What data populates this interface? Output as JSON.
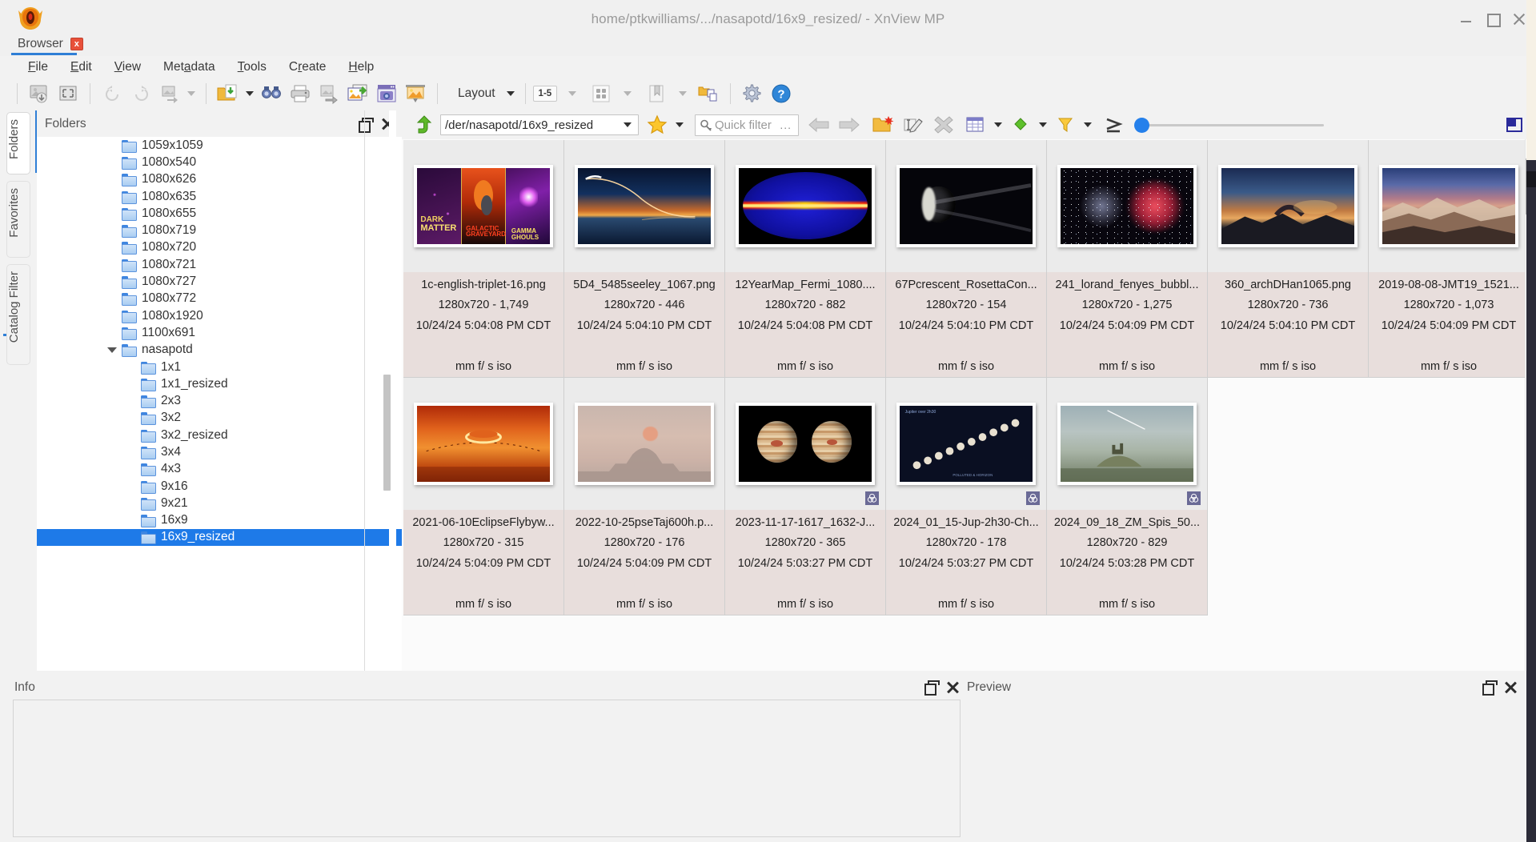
{
  "window": {
    "title": "home/ptkwilliams/.../nasapotd/16x9_resized/ - XnView MP",
    "minimize_label": "Minimize",
    "maximize_label": "Maximize",
    "close_label": "Close"
  },
  "tab": {
    "label": "Browser",
    "close_label": "x"
  },
  "menu": [
    {
      "name": "file",
      "label": "File"
    },
    {
      "name": "edit",
      "label": "Edit"
    },
    {
      "name": "view",
      "label": "View"
    },
    {
      "name": "metadata",
      "label": "Metadata"
    },
    {
      "name": "tools",
      "label": "Tools"
    },
    {
      "name": "create",
      "label": "Create"
    },
    {
      "name": "help",
      "label": "Help"
    }
  ],
  "toolbar": {
    "layout_label": "Layout",
    "page_range_label": "1-5",
    "icons": [
      "open-image-icon",
      "fit-window-icon",
      "rotate-left-icon",
      "rotate-right-icon",
      "transform-icon",
      "open-folder-icon",
      "find-icon",
      "print-icon",
      "batch-convert-icon",
      "export-icon",
      "screen-capture-icon",
      "slideshow-icon",
      "thumbnail-size-icon",
      "bookmark-icon",
      "copy-to-folder-icon",
      "settings-icon",
      "help-icon"
    ]
  },
  "rail": {
    "tabs": [
      {
        "name": "folders",
        "label": "Folders",
        "active": true
      },
      {
        "name": "favorites",
        "label": "Favorites",
        "active": false
      },
      {
        "name": "catalog-filter",
        "label": "Catalog Filter",
        "active": false
      }
    ]
  },
  "folders_panel": {
    "title": "Folders",
    "tree": [
      {
        "label": "1059x1059",
        "indent": 1,
        "expander": "none",
        "selected": false
      },
      {
        "label": "1080x540",
        "indent": 1,
        "expander": "none",
        "selected": false
      },
      {
        "label": "1080x626",
        "indent": 1,
        "expander": "none",
        "selected": false
      },
      {
        "label": "1080x635",
        "indent": 1,
        "expander": "none",
        "selected": false
      },
      {
        "label": "1080x655",
        "indent": 1,
        "expander": "none",
        "selected": false
      },
      {
        "label": "1080x719",
        "indent": 1,
        "expander": "none",
        "selected": false
      },
      {
        "label": "1080x720",
        "indent": 1,
        "expander": "none",
        "selected": false
      },
      {
        "label": "1080x721",
        "indent": 1,
        "expander": "none",
        "selected": false
      },
      {
        "label": "1080x727",
        "indent": 1,
        "expander": "none",
        "selected": false
      },
      {
        "label": "1080x772",
        "indent": 1,
        "expander": "none",
        "selected": false
      },
      {
        "label": "1080x1920",
        "indent": 1,
        "expander": "none",
        "selected": false
      },
      {
        "label": "1100x691",
        "indent": 1,
        "expander": "none",
        "selected": false
      },
      {
        "label": "nasapotd",
        "indent": 1,
        "expander": "expanded",
        "selected": false
      },
      {
        "label": "1x1",
        "indent": 2,
        "expander": "none",
        "selected": false
      },
      {
        "label": "1x1_resized",
        "indent": 2,
        "expander": "none",
        "selected": false
      },
      {
        "label": "2x3",
        "indent": 2,
        "expander": "none",
        "selected": false
      },
      {
        "label": "3x2",
        "indent": 2,
        "expander": "none",
        "selected": false
      },
      {
        "label": "3x2_resized",
        "indent": 2,
        "expander": "none",
        "selected": false
      },
      {
        "label": "3x4",
        "indent": 2,
        "expander": "none",
        "selected": false
      },
      {
        "label": "4x3",
        "indent": 2,
        "expander": "none",
        "selected": false
      },
      {
        "label": "9x16",
        "indent": 2,
        "expander": "none",
        "selected": false
      },
      {
        "label": "9x21",
        "indent": 2,
        "expander": "none",
        "selected": false
      },
      {
        "label": "16x9",
        "indent": 2,
        "expander": "none",
        "selected": false
      },
      {
        "label": "16x9_resized",
        "indent": 2,
        "expander": "none",
        "selected": true
      }
    ]
  },
  "navbar": {
    "path_value": "der/nasapotd/16x9_resized/",
    "quick_filter_placeholder": "Quick filter",
    "quick_filter_value": "",
    "quick_filter_more": "...",
    "icons": [
      "navigate-up-icon",
      "path-dropdown-caret",
      "favorite-star-icon",
      "star-dropdown-caret",
      "quick-filter-search-icon",
      "back-arrow-icon",
      "forward-arrow-icon",
      "new-folder-icon",
      "rename-icon",
      "delete-icon",
      "details-view-icon",
      "color-label-icon",
      "filter-icon",
      "sort-icon",
      "zoom-slider",
      "preview-pane-icon"
    ]
  },
  "grid": {
    "items": [
      {
        "filename": "1c-english-triplet-16.png",
        "dims": "1280x720 - 1,749",
        "date": "10/24/24 5:04:08 PM CDT",
        "exif": "mm f/ s iso",
        "badge": false
      },
      {
        "filename": "5D4_5485seeley_1067.png",
        "dims": "1280x720 - 446",
        "date": "10/24/24 5:04:10 PM CDT",
        "exif": "mm f/ s iso",
        "badge": false
      },
      {
        "filename": "12YearMap_Fermi_1080....",
        "dims": "1280x720 - 882",
        "date": "10/24/24 5:04:08 PM CDT",
        "exif": "mm f/ s iso",
        "badge": false
      },
      {
        "filename": "67Pcrescent_RosettaCon...",
        "dims": "1280x720 - 154",
        "date": "10/24/24 5:04:10 PM CDT",
        "exif": "mm f/ s iso",
        "badge": false
      },
      {
        "filename": "241_lorand_fenyes_bubbl...",
        "dims": "1280x720 - 1,275",
        "date": "10/24/24 5:04:09 PM CDT",
        "exif": "mm f/ s iso",
        "badge": false
      },
      {
        "filename": "360_archDHan1065.png",
        "dims": "1280x720 - 736",
        "date": "10/24/24 5:04:10 PM CDT",
        "exif": "mm f/ s iso",
        "badge": false
      },
      {
        "filename": "2019-08-08-JMT19_1521...",
        "dims": "1280x720 - 1,073",
        "date": "10/24/24 5:04:09 PM CDT",
        "exif": "mm f/ s iso",
        "badge": false
      },
      {
        "filename": "2021-06-10EclipseFlybyw...",
        "dims": "1280x720 - 315",
        "date": "10/24/24 5:04:09 PM CDT",
        "exif": "mm f/ s iso",
        "badge": false
      },
      {
        "filename": "2022-10-25pseTaj600h.p...",
        "dims": "1280x720 - 176",
        "date": "10/24/24 5:04:09 PM CDT",
        "exif": "mm f/ s iso",
        "badge": false
      },
      {
        "filename": "2023-11-17-1617_1632-J...",
        "dims": "1280x720 - 365",
        "date": "10/24/24 5:03:27 PM CDT",
        "exif": "mm f/ s iso",
        "badge": true
      },
      {
        "filename": "2024_01_15-Jup-2h30-Ch...",
        "dims": "1280x720 - 178",
        "date": "10/24/24 5:03:27 PM CDT",
        "exif": "mm f/ s iso",
        "badge": true
      },
      {
        "filename": "2024_09_18_ZM_Spis_50...",
        "dims": "1280x720 - 829",
        "date": "10/24/24 5:03:28 PM CDT",
        "exif": "mm f/ s iso",
        "badge": true
      }
    ]
  },
  "info_panel": {
    "title": "Info"
  },
  "preview_panel": {
    "title": "Preview"
  },
  "colors": {
    "accent": "#2f7fd6",
    "selection": "#1e7ae8",
    "meta_bg": "#e8dedc",
    "cell_bg": "#ebebeb",
    "chrome_bg": "#f2f2f2"
  }
}
